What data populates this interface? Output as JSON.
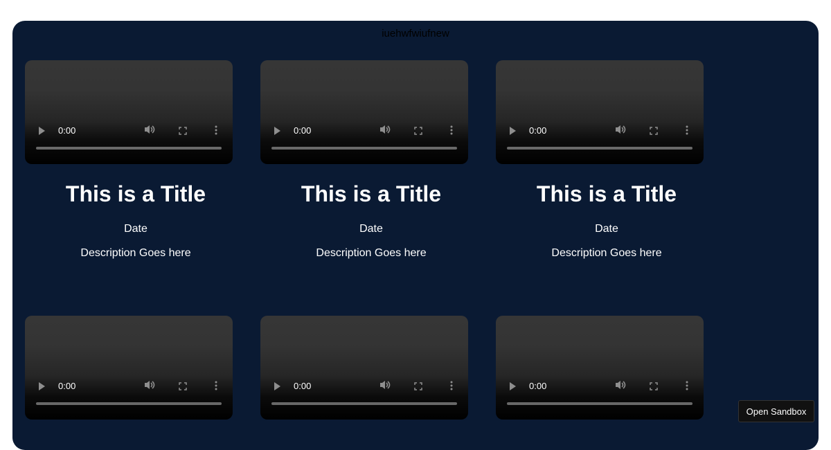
{
  "header": {
    "title": "iuehwfwiufnew"
  },
  "video_player": {
    "time": "0:00"
  },
  "cards": [
    {
      "title": "This is a Title",
      "date": "Date",
      "description": "Description Goes here"
    },
    {
      "title": "This is a Title",
      "date": "Date",
      "description": "Description Goes here"
    },
    {
      "title": "This is a Title",
      "date": "Date",
      "description": "Description Goes here"
    }
  ],
  "open_sandbox": {
    "label": "Open Sandbox"
  },
  "colors": {
    "page_bg": "#0a1a33",
    "text": "#ffffff"
  }
}
